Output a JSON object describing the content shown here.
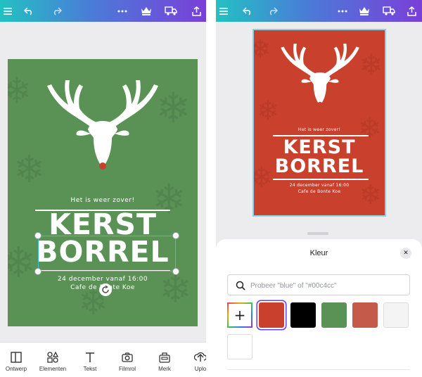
{
  "left": {
    "poster": {
      "tagline": "Het is weer zover!",
      "title_line1": "KERST",
      "title_line2": "BORREL",
      "date": "24 december vanaf 16:00",
      "venue": "Cafe de Bonte Koe",
      "background": "#5a9256"
    },
    "toolbar": [
      {
        "label": "Ontwerp",
        "icon": "layout-icon"
      },
      {
        "label": "Elementen",
        "icon": "shapes-icon"
      },
      {
        "label": "Tekst",
        "icon": "text-icon"
      },
      {
        "label": "Filmrol",
        "icon": "camera-icon"
      },
      {
        "label": "Merk",
        "icon": "brand-kit-icon"
      },
      {
        "label": "Uplo",
        "icon": "upload-icon"
      }
    ]
  },
  "right": {
    "poster": {
      "tagline": "Het is weer zover!",
      "title_line1": "KERST",
      "title_line2": "BORREL",
      "date": "24 december vanaf 16:00",
      "venue": "Cafe de Bonte Koe",
      "background": "#c9402c"
    },
    "color_panel": {
      "title": "Kleur",
      "search_placeholder": "Probeer \"blue\" of \"#00c4cc\"",
      "swatches": [
        "#c9402c",
        "#000000",
        "#5a9256",
        "#c45a4a",
        "#f4f4f4",
        "#ffffff"
      ],
      "selected_swatch": "#c9402c"
    }
  },
  "colors": {
    "accent_selection": "#35c2d4",
    "topbar_gradient": [
      "#22c1c3",
      "#7a3fd8"
    ]
  }
}
